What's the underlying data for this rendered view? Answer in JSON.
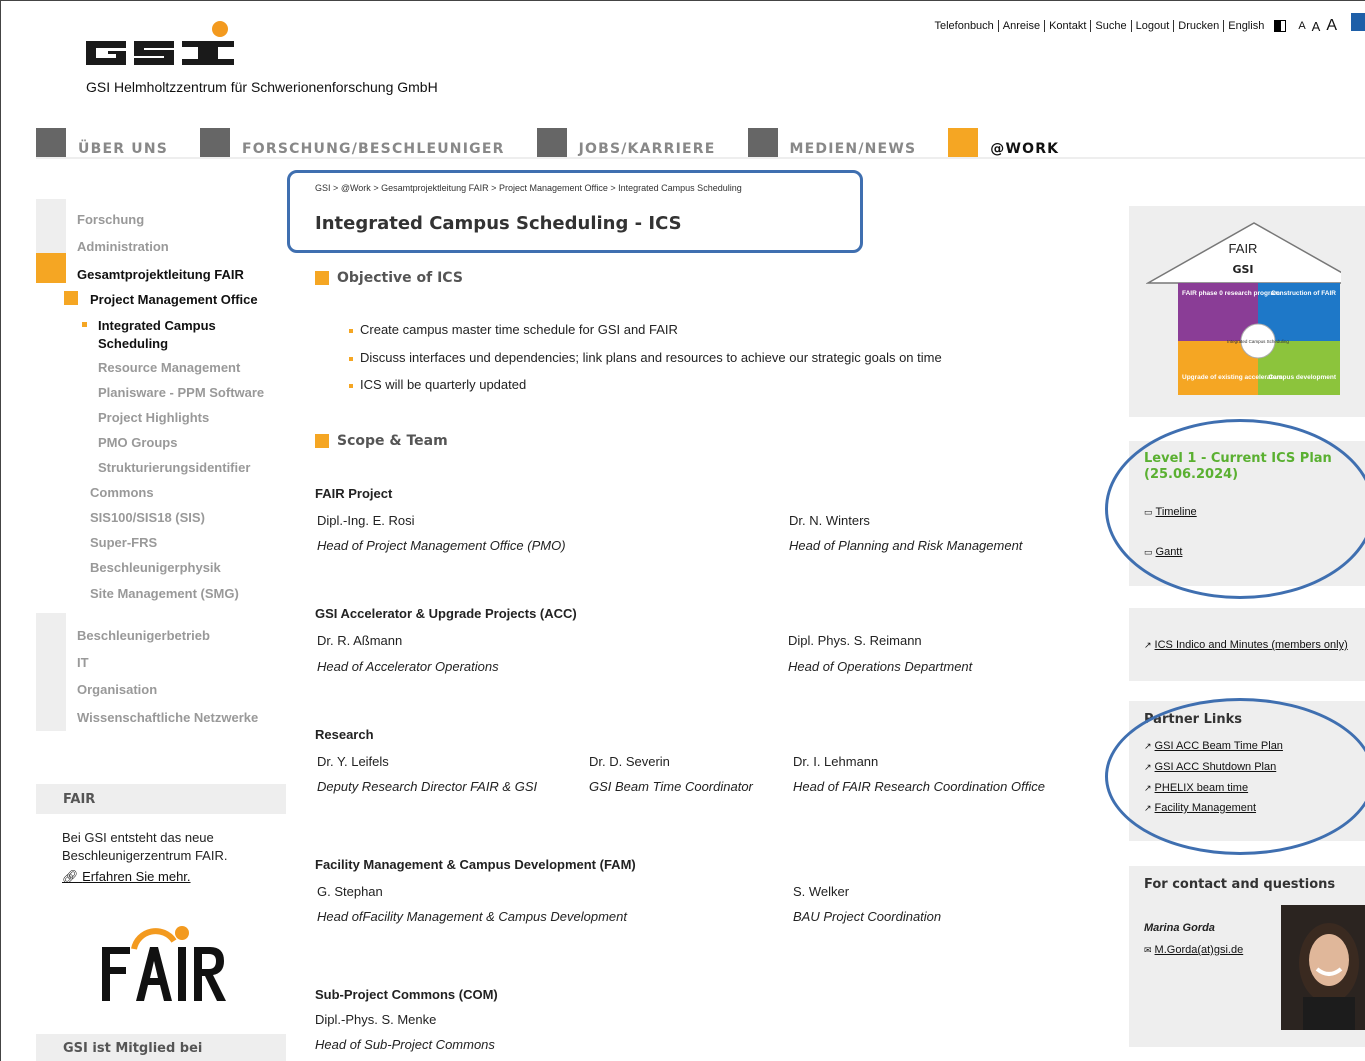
{
  "utility": {
    "links": [
      "Telefonbuch",
      "Anreise",
      "Kontakt",
      "Suche",
      "Logout",
      "Drucken",
      "English"
    ],
    "font_sizes": [
      "A",
      "A",
      "A"
    ]
  },
  "header": {
    "company_name": "GSI Helmholtzzentrum für Schwerionenforschung GmbH"
  },
  "mainnav": [
    "ÜBER UNS",
    "FORSCHUNG/BESCHLEUNIGER",
    "JOBS/KARRIERE",
    "MEDIEN/NEWS",
    "@WORK"
  ],
  "sidebar": {
    "items": [
      "Forschung",
      "Administration",
      "Gesamtprojektleitung FAIR",
      "Project Management Office",
      "Integrated Campus",
      "Scheduling",
      "Resource Management",
      "Planisware - PPM Software",
      "Project Highlights",
      "PMO Groups",
      "Strukturierungsidentifier",
      "Commons",
      "SIS100/SIS18 (SIS)",
      "Super-FRS",
      "Beschleunigerphysik",
      "Site Management (SMG)",
      "Beschleunigerbetrieb",
      "IT",
      "Organisation",
      "Wissenschaftliche Netzwerke"
    ],
    "fair_title": "FAIR",
    "fair_text": "Bei GSI entsteht das neue Beschleunigerzentrum FAIR.",
    "fair_link": "Erfahren Sie mehr.",
    "member_title": "GSI ist Mitglied bei"
  },
  "breadcrumb": [
    "GSI",
    ">",
    "@Work",
    ">",
    "Gesamtprojektleitung FAIR",
    ">",
    "Project Management Office",
    ">",
    "Integrated Campus Scheduling"
  ],
  "main": {
    "title": "Integrated Campus Scheduling - ICS",
    "objective_heading": "Objective of ICS",
    "objectives": [
      "Create campus master time schedule for GSI and FAIR",
      "Discuss interfaces und dependencies; link plans and resources to achieve our strategic goals on time",
      "ICS will be quarterly updated"
    ],
    "scope_heading": "Scope & Team",
    "groups": [
      {
        "title": "FAIR Project",
        "people": [
          {
            "name": "Dipl.-Ing. E. Rosi",
            "role": "Head of Project Management Office (PMO)"
          },
          {
            "name": "Dr. N. Winters",
            "role": "Head of Planning and Risk Management"
          }
        ]
      },
      {
        "title": "GSI Accelerator & Upgrade Projects (ACC)",
        "people": [
          {
            "name": "Dr. R. Aßmann",
            "role": "Head of Accelerator Operations"
          },
          {
            "name": "Dipl. Phys. S. Reimann",
            "role": "Head of Operations Department"
          }
        ]
      },
      {
        "title": "Research",
        "people": [
          {
            "name": "Dr. Y. Leifels",
            "role": "Deputy Research Director FAIR & GSI"
          },
          {
            "name": "Dr. D. Severin",
            "role": "GSI Beam Time Coordinator"
          },
          {
            "name": "Dr. I. Lehmann",
            "role": "Head of FAIR Research Coordination Office"
          }
        ]
      },
      {
        "title": "Facility Management & Campus Development (FAM)",
        "people": [
          {
            "name": "G. Stephan",
            "role": "Head ofFacility Management & Campus Development"
          },
          {
            "name": "S. Welker",
            "role": "BAU Project Coordination"
          }
        ]
      },
      {
        "title": "Sub-Project Commons (COM)",
        "people": [
          {
            "name": "Dipl.-Phys. S. Menke",
            "role": "Head of Sub-Project Commons"
          }
        ]
      }
    ]
  },
  "right": {
    "graphic": {
      "fair": "FAIR",
      "gsi": "GSI",
      "piece1": "FAIR phase 0 research program",
      "piece2": "Construction of FAIR",
      "center": "Integrated Campus Scheduling",
      "piece3": "Upgrade of existing accelerators",
      "piece4": "Campus development"
    },
    "level_heading": "Level 1 - Current ICS Plan (25.06.2024)",
    "timeline_link": "Timeline",
    "gantt_link": "Gantt",
    "indico_link": "ICS Indico and Minutes (members only)",
    "partner_heading": "Partner Links",
    "partner_links": [
      "GSI ACC Beam Time Plan",
      "GSI ACC Shutdown Plan",
      "PHELIX beam time",
      "Facility Management"
    ],
    "contact_heading": "For contact and questions",
    "contact_name": "Marina Gorda",
    "contact_email": "M.Gorda(at)gsi.de"
  },
  "colors": {
    "accent_orange": "#f5a623",
    "nav_gray": "#666666",
    "highlight_blue": "#3f6fb0",
    "level_green": "#5ab031"
  }
}
